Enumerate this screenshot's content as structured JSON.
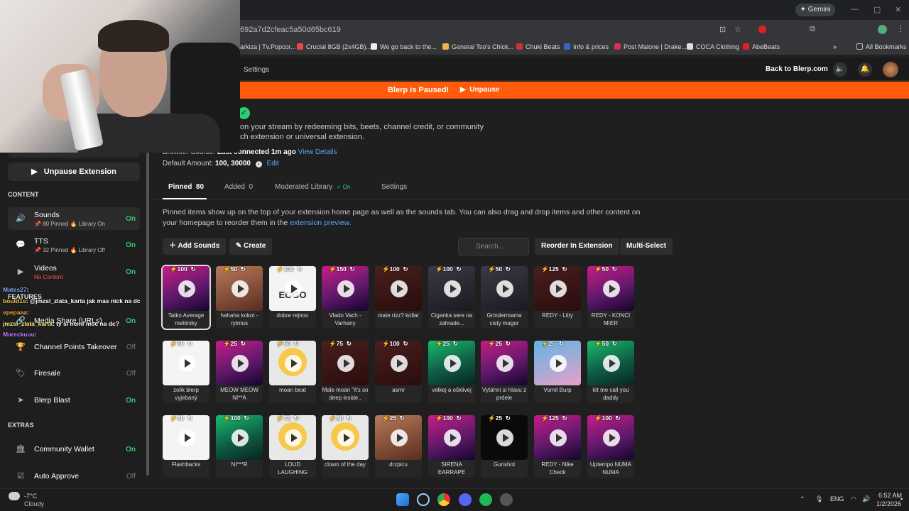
{
  "browser": {
    "gemini_label": "Gemini",
    "url_fragment": "692a7d2cfeac5a50d65bc619",
    "bookmarks": [
      "arkiza | Tv.Popcor...",
      "Crucial 8GB (2x4GB)...",
      "We go back to the...",
      "General Tso's Chick...",
      "Chuki Beats",
      "Info & prices",
      "Post Malone | Drake...",
      "COCA Clothing",
      "AbeBeats"
    ],
    "all_bookmarks": "All Bookmarks"
  },
  "topbar": {
    "settings": "Settings",
    "back": "Back to Blerp.com"
  },
  "banner": {
    "text": "Blerp is Paused!",
    "unpause": "Unpause"
  },
  "intro": {
    "line1": "on your stream by redeeming bits, beets, channel credit, or community",
    "line2": "ch extension or universal extension.",
    "browser_source_label": "Browser Source:",
    "browser_source_value": "Last connected 1m ago",
    "view_details": "View Details",
    "default_amount_label": "Default Amount:",
    "default_amount_value": "100, 30000",
    "edit": "Edit"
  },
  "tabs": [
    {
      "label": "Pinned",
      "count": "80"
    },
    {
      "label": "Added",
      "count": "0"
    },
    {
      "label": "Moderated Library",
      "status": "✓ On"
    },
    {
      "label": "Settings"
    }
  ],
  "pinned_info": {
    "text": "Pinned items show up on the top of your extension home page as well as the sounds tab. You can also drag and drop items and other content on your homepage to reorder them in the",
    "link": "extension preview."
  },
  "actions": {
    "add_sounds": "Add Sounds",
    "create": "Create",
    "search_placeholder": "Search...",
    "reorder": "Reorder In Extension",
    "multi_select": "Multi-Select"
  },
  "sounds": [
    {
      "price": "100",
      "name": "Tatko Average melóniky",
      "thumb": "pink"
    },
    {
      "price": "50",
      "name": "hahaha kokot - rytmus",
      "thumb": "face"
    },
    {
      "price": "100",
      "name": "dobre rejnou",
      "thumb": "white",
      "overlay": "EGGO"
    },
    {
      "price": "150",
      "name": "Vlado Vach - Varhany",
      "thumb": "pink"
    },
    {
      "price": "100",
      "name": "mate rizz? kollar",
      "thumb": "dark"
    },
    {
      "price": "100",
      "name": "Ciganka sere na zahrade...",
      "thumb": "street"
    },
    {
      "price": "50",
      "name": "Grindermama cisty magor",
      "thumb": "street"
    },
    {
      "price": "125",
      "name": "REDY - Litty",
      "thumb": "dark"
    },
    {
      "price": "50",
      "name": "REDY - KONCI MIER",
      "thumb": "pink"
    },
    {
      "price": "50",
      "name": "zolik blerp vyjebaný",
      "thumb": "white"
    },
    {
      "price": "25",
      "name": "MEOW MEOW NI**A",
      "thumb": "pink"
    },
    {
      "price": "50",
      "name": "moan beat",
      "thumb": "emoji"
    },
    {
      "price": "75",
      "name": "Male moan \"it's so deep inside..",
      "thumb": "dark"
    },
    {
      "price": "100",
      "name": "asmr",
      "thumb": "dark"
    },
    {
      "price": "25",
      "name": "velkej a ošklivej",
      "thumb": "green"
    },
    {
      "price": "25",
      "name": "Vytáhni si hlavu z prdele",
      "thumb": "pink"
    },
    {
      "price": "25",
      "name": "Vomit Burp",
      "thumb": "blue"
    },
    {
      "price": "50",
      "name": "let me call you daddy",
      "thumb": "green"
    },
    {
      "price": "50",
      "name": "Flashbacks",
      "thumb": "white"
    },
    {
      "price": "100",
      "name": "NI***R",
      "thumb": "green"
    },
    {
      "price": "75",
      "name": "LOUD LAUGHING",
      "thumb": "emoji"
    },
    {
      "price": "50",
      "name": "clown of the day",
      "thumb": "emoji"
    },
    {
      "price": "25",
      "name": "drzpicu",
      "thumb": "face"
    },
    {
      "price": "100",
      "name": "SIRENA EARRAPE",
      "thumb": "pink"
    },
    {
      "price": "25",
      "name": "Gunshot",
      "thumb": "black"
    },
    {
      "price": "125",
      "name": "REDY - Nike Check",
      "thumb": "pink"
    },
    {
      "price": "100",
      "name": "Uptempo NUMA NUMA",
      "thumb": "pink"
    }
  ],
  "sidebar": {
    "unpause_extension": "Unpause Extension",
    "content_heading": "CONTENT",
    "features_heading": "FEATURES",
    "extras_heading": "EXTRAS",
    "items": [
      {
        "label": "Sounds",
        "sub": "📌 80 Pinned  🔥 Library On",
        "state": "On"
      },
      {
        "label": "TTS",
        "sub": "📌 32 Pinned  🔥 Library Off",
        "state": "On"
      },
      {
        "label": "Videos",
        "sub": "No Content",
        "state": "On"
      },
      {
        "label": "Media Share (URLs)",
        "sub": "",
        "state": "On"
      },
      {
        "label": "Channel Points Takeover",
        "sub": "",
        "state": "Off"
      },
      {
        "label": "Firesale",
        "sub": "",
        "state": "Off"
      },
      {
        "label": "Blerp Blast",
        "sub": "",
        "state": "On"
      },
      {
        "label": "Community Wallet",
        "sub": "",
        "state": "On"
      },
      {
        "label": "Auto Approve",
        "sub": "",
        "state": "Off"
      }
    ]
  },
  "chat": [
    {
      "user": "Mates27",
      "text": ":"
    },
    {
      "user": "bould1s",
      "text": ": @jmzsl_zlata_karta jak mas nick na dc"
    },
    {
      "user": "vpepaaa",
      "text": ":"
    },
    {
      "user": "jmzsl_zlata_karta",
      "text": ": ty si nemi moc na dc?"
    },
    {
      "user": "Mareckuuu",
      "text": ":"
    }
  ],
  "taskbar": {
    "temp": "-7°C",
    "weather": "Cloudy",
    "lang": "ENG",
    "time": "6:52 AM",
    "date": "1/2/2026"
  }
}
